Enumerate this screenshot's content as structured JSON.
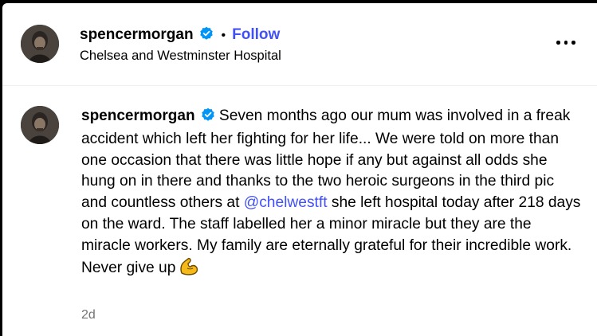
{
  "post": {
    "username": "spencermorgan",
    "separator": "•",
    "follow_label": "Follow",
    "location": "Chelsea and Westminster Hospital",
    "more_label": "More options"
  },
  "caption": {
    "username": "spencermorgan",
    "text_before_mention": "Seven months ago our mum was involved in a freak accident which left her fighting for her life... We were told on more than one occasion that there was little hope if any but against all odds she hung on in there and thanks to the two heroic surgeons in the third pic and countless others at ",
    "mention": "@chelwestft",
    "text_after_mention": " she left hospital today after 218 days on the ward. The staff labelled her a minor miracle but they are the miracle workers. My family are eternally grateful for their incredible work. Never give up",
    "emoji": "flexed-biceps"
  },
  "timestamp": "2d",
  "colors": {
    "link": "#4150f7",
    "verified": "#0095f6",
    "muted": "#737373"
  },
  "icons": {
    "verified": "verified-badge-icon",
    "more": "more-horizontal-icon",
    "emoji": "flexed-biceps-emoji"
  }
}
